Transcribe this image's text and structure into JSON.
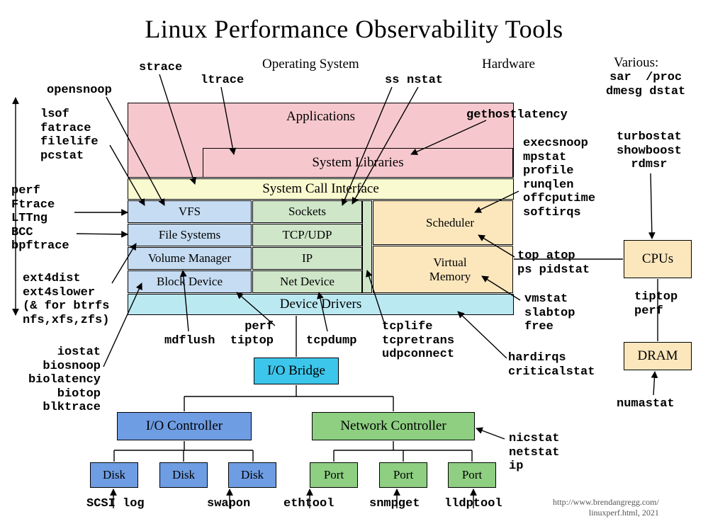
{
  "title": "Linux Performance Observability Tools",
  "headers": {
    "os": "Operating System",
    "hw": "Hardware",
    "various": "Various:"
  },
  "various_tools": "sar  /proc\ndmesg dstat",
  "boxes": {
    "applications": "Applications",
    "sys_libraries": "System Libraries",
    "syscall_if": "System Call Interface",
    "vfs": "VFS",
    "file_systems": "File Systems",
    "volume_manager": "Volume Manager",
    "block_device": "Block Device",
    "sockets": "Sockets",
    "tcp_udp": "TCP/UDP",
    "ip": "IP",
    "net_device": "Net Device",
    "scheduler": "Scheduler",
    "vmem": "Virtual\nMemory",
    "device_drivers": "Device Drivers",
    "io_bridge": "I/O Bridge",
    "io_controller": "I/O Controller",
    "net_controller": "Network Controller",
    "disk": "Disk",
    "port": "Port",
    "cpus": "CPUs",
    "dram": "DRAM"
  },
  "tools": {
    "strace": "strace",
    "ltrace": "ltrace",
    "ss": "ss",
    "nstat": "nstat",
    "opensnoop": "opensnoop",
    "lsof_group": "lsof\nfatrace\nfilelife\npcstat",
    "perf_group": "perf\nFtrace\nLTTng\nBCC\nbpftrace",
    "ext4_group": "ext4dist\next4slower\n(& for btrfs\nnfs,xfs,zfs)",
    "iostat_group": "iostat\nbiosnoop\nbiolatency\nbiotop\nblktrace",
    "gethostlatency": "gethostlatency",
    "execsnoop_group": "execsnoop\nmpstat\nprofile\nrunqlen\noffcputime\nsoftirqs",
    "turbostat_group": "turbostat\nshowboost\nrdmsr",
    "top_group": "top atop\nps pidstat",
    "tiptop_perf": "tiptop\nperf",
    "vmstat_group": "vmstat\nslabtop\nfree",
    "hardirqs_group": "hardirqs\ncriticalstat",
    "numastat": "numastat",
    "nicstat_group": "nicstat\nnetstat\nip",
    "mdflush": "mdflush",
    "perf_tiptop": "perf\ntiptop",
    "tcpdump": "tcpdump",
    "tcplife_group": "tcplife\ntcpretrans\nudpconnect",
    "scsi_log": "SCSI log",
    "swapon": "swapon",
    "ethtool": "ethtool",
    "snmpget": "snmpget",
    "lldptool": "lldptool"
  },
  "footer": "http://www.brendangregg.com/\nlinuxperf.html, 2021",
  "colors": {
    "pink": "#f6c8cd",
    "yellow": "#fafad0",
    "lightblue": "#c5dcf2",
    "lightgreen": "#cfe6c9",
    "peach": "#fce7bd",
    "cyan": "#bbe9f2",
    "brightcyan": "#3cc6eb",
    "blue": "#6f9de3",
    "green": "#8ecf82"
  }
}
